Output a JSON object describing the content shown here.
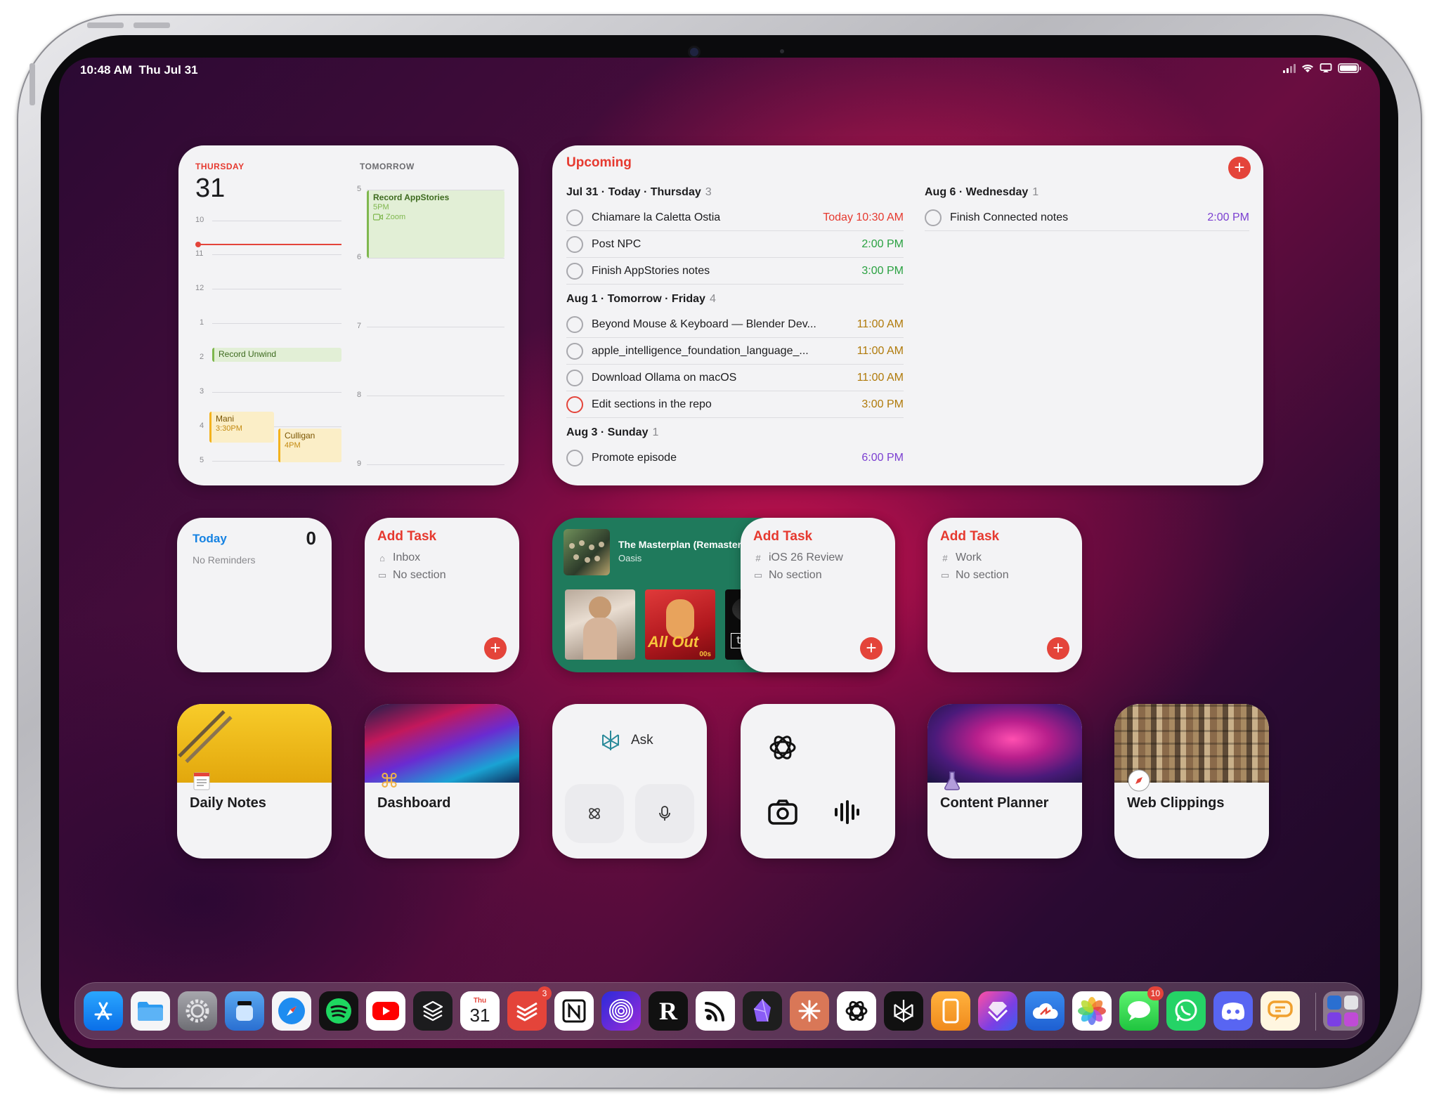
{
  "status_bar": {
    "time": "10:48 AM",
    "date": "Thu Jul 31"
  },
  "calendar_widget": {
    "today_label": "THURSDAY",
    "today_date": "31",
    "tomorrow_label": "TOMORROW",
    "today_hours": [
      "10",
      "11",
      "12",
      "1",
      "2",
      "3",
      "4",
      "5"
    ],
    "tomorrow_hours": [
      "5",
      "6",
      "7",
      "8",
      "9"
    ],
    "events": {
      "record_appstories": {
        "title": "Record AppStories",
        "time": "5PM",
        "location": "Zoom"
      },
      "record_unwind": {
        "title": "Record Unwind"
      },
      "mani": {
        "title": "Mani",
        "time": "3:30PM"
      },
      "culligan": {
        "title": "Culligan",
        "time": "4PM"
      }
    }
  },
  "upcoming_widget": {
    "title": "Upcoming",
    "add_label": "+",
    "groups": [
      {
        "date": "Jul 31",
        "label": "Today",
        "weekday": "Thursday",
        "count": "3",
        "tasks": [
          {
            "name": "Chiamare la Caletta Ostia",
            "time": "Today 10:30 AM",
            "color": "#e6392f"
          },
          {
            "name": "Post NPC",
            "time": "2:00 PM",
            "color": "#2aa141"
          },
          {
            "name": "Finish AppStories notes",
            "time": "3:00 PM",
            "color": "#2aa141"
          }
        ]
      },
      {
        "date": "Aug 1",
        "label": "Tomorrow",
        "weekday": "Friday",
        "count": "4",
        "tasks": [
          {
            "name": "Beyond Mouse & Keyboard — Blender Dev...",
            "time": "11:00 AM",
            "color": "#b07a0a"
          },
          {
            "name": "apple_intelligence_foundation_language_...",
            "time": "11:00 AM",
            "color": "#b07a0a"
          },
          {
            "name": "Download Ollama on macOS",
            "time": "11:00 AM",
            "color": "#b07a0a"
          },
          {
            "name": "Edit sections in the repo",
            "time": "3:00 PM",
            "color": "#b07a0a",
            "circle": "red"
          }
        ]
      },
      {
        "date": "Aug 3",
        "weekday": "Sunday",
        "count": "1",
        "tasks": [
          {
            "name": "Promote episode",
            "time": "6:00 PM",
            "color": "#7b3fd1"
          }
        ]
      },
      {
        "date": "Aug 6",
        "weekday": "Wednesday",
        "count": "1",
        "tasks": [
          {
            "name": "Finish Connected notes",
            "time": "2:00 PM",
            "color": "#7b3fd1"
          }
        ]
      }
    ]
  },
  "today_reminders": {
    "title": "Today",
    "count": "0",
    "subtitle": "No Reminders"
  },
  "add_task_widgets": [
    {
      "title": "Add Task",
      "project": "Inbox",
      "section": "No section"
    },
    {
      "title": "Add Task",
      "project": "iOS 26 Review",
      "section": "No section"
    },
    {
      "title": "Add Task",
      "project": "Work",
      "section": "No section"
    }
  ],
  "spotify_widget": {
    "song": "The Masterplan (Remastered Edition)",
    "artist": "Oasis",
    "album_texts": {
      "all_out": "All Out",
      "all_out_sub": "00s",
      "texas": "texas"
    }
  },
  "shortcuts": {
    "daily_notes": "Daily Notes",
    "dashboard": "Dashboard",
    "content_planner": "Content Planner",
    "web_clippings": "Web Clippings"
  },
  "perplexity_widget": {
    "ask_label": "Ask"
  },
  "dock": {
    "calendar_weekday": "Thu",
    "calendar_day": "31",
    "todoist_badge": "3",
    "messages_badge": "10",
    "apps": [
      "app-store",
      "files",
      "settings",
      "trickle",
      "safari",
      "spotify",
      "youtube",
      "layers",
      "calendar",
      "todoist",
      "notion",
      "fingerprint",
      "readwise",
      "rss",
      "obsidian",
      "claude",
      "chatgpt",
      "perplexity",
      "ipad-app",
      "shortcuts",
      "cloud-app",
      "photos",
      "messages",
      "whatsapp",
      "discord",
      "copilot",
      "app-library"
    ]
  }
}
